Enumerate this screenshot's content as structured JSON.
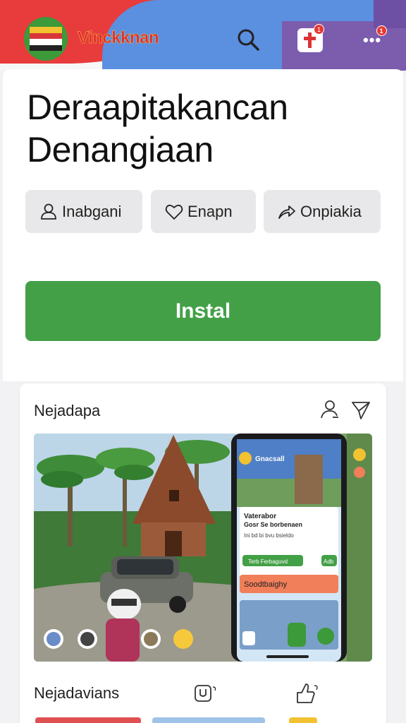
{
  "header": {
    "app_name": "Vinckknan",
    "search_icon": "search-icon",
    "notification_badge": "1",
    "more_badge": "1",
    "more_label": "•••"
  },
  "main": {
    "title_line1": "Deraapitakancan",
    "title_line2": "Denangiaan",
    "actions": [
      {
        "label": "Inabgani",
        "icon": "user-icon"
      },
      {
        "label": "Enapn",
        "icon": "heart-icon"
      },
      {
        "label": "Onpiakia",
        "icon": "share-icon"
      }
    ],
    "install_label": "Instal"
  },
  "preview": {
    "title": "Nejadapa",
    "phone": {
      "app_title": "Gnacsall",
      "dialog_title": "Vaterabor",
      "dialog_subtitle": "Gosr Se borbenaen",
      "dialog_line": "Ini bd bi bvu bsieldo",
      "button_green": "Terb Ferbaguvd",
      "button_small": "Adb",
      "orange_label": "Soodtbaighy"
    },
    "bottom_title": "Nejadavians"
  },
  "colors": {
    "accent_green": "#43a047",
    "brand_red": "#e0292e",
    "header_blue": "#5b8fe0",
    "header_purple": "#7b5cad"
  }
}
